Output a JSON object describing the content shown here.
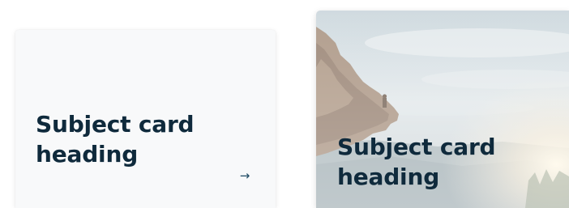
{
  "cards": [
    {
      "heading": "Subject card heading",
      "arrow_glyph": "→",
      "arrow_icon": "arrow-right-icon",
      "variant": "plain"
    },
    {
      "heading": "Subject card heading",
      "variant": "image",
      "background_image": "cliff-sunset-photo"
    }
  ],
  "colors": {
    "heading_text": "#0f2a3c",
    "arrow": "#1d4a63",
    "plain_card_bg": "#f8f9fa"
  }
}
